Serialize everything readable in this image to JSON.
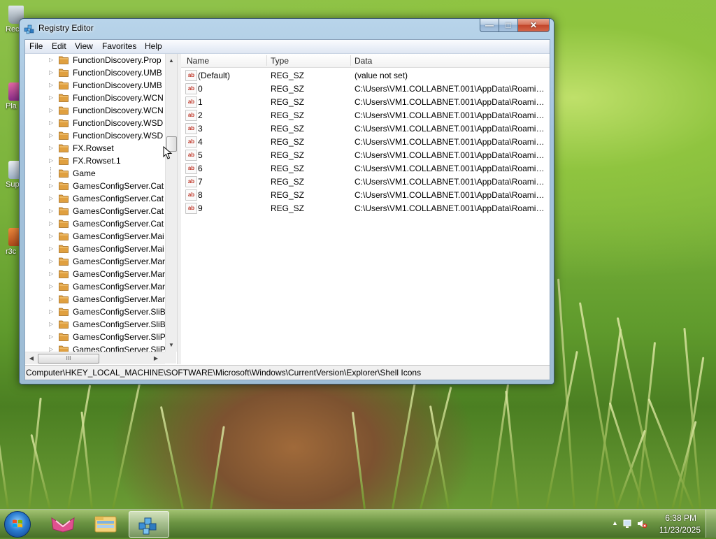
{
  "window": {
    "title": "Registry Editor",
    "min_glyph": "—",
    "max_glyph": "□",
    "close_glyph": "✕"
  },
  "menu": [
    "File",
    "Edit",
    "View",
    "Favorites",
    "Help"
  ],
  "tree": {
    "items": [
      {
        "label": "FunctionDiscovery.Prop",
        "expandable": true
      },
      {
        "label": "FunctionDiscovery.UMB",
        "expandable": true
      },
      {
        "label": "FunctionDiscovery.UMB",
        "expandable": true
      },
      {
        "label": "FunctionDiscovery.WCN",
        "expandable": true
      },
      {
        "label": "FunctionDiscovery.WCN",
        "expandable": true
      },
      {
        "label": "FunctionDiscovery.WSD",
        "expandable": true
      },
      {
        "label": "FunctionDiscovery.WSD",
        "expandable": true
      },
      {
        "label": "FX.Rowset",
        "expandable": true
      },
      {
        "label": "FX.Rowset.1",
        "expandable": true
      },
      {
        "label": "Game",
        "expandable": false
      },
      {
        "label": "GamesConfigServer.Cat",
        "expandable": true
      },
      {
        "label": "GamesConfigServer.Cat",
        "expandable": true
      },
      {
        "label": "GamesConfigServer.Cat",
        "expandable": true
      },
      {
        "label": "GamesConfigServer.Cat",
        "expandable": true
      },
      {
        "label": "GamesConfigServer.Mai",
        "expandable": true
      },
      {
        "label": "GamesConfigServer.Mai",
        "expandable": true
      },
      {
        "label": "GamesConfigServer.Mar",
        "expandable": true
      },
      {
        "label": "GamesConfigServer.Mar",
        "expandable": true
      },
      {
        "label": "GamesConfigServer.Mar",
        "expandable": true
      },
      {
        "label": "GamesConfigServer.Mar",
        "expandable": true
      },
      {
        "label": "GamesConfigServer.SliB",
        "expandable": true
      },
      {
        "label": "GamesConfigServer.SliB",
        "expandable": true
      },
      {
        "label": "GamesConfigServer.SliP",
        "expandable": true
      },
      {
        "label": "GamesConfigServer.SliP",
        "expandable": true
      }
    ],
    "scroll_up": "▲",
    "scroll_down": "▼",
    "scroll_left": "◀",
    "scroll_right": "▶",
    "hthumb_grip": "III"
  },
  "list": {
    "columns": [
      "Name",
      "Type",
      "Data"
    ],
    "rows": [
      {
        "name": "(Default)",
        "type": "REG_SZ",
        "data": "(value not set)"
      },
      {
        "name": "0",
        "type": "REG_SZ",
        "data": "C:\\Users\\VM1.COLLABNET.001\\AppData\\Roaming..."
      },
      {
        "name": "1",
        "type": "REG_SZ",
        "data": "C:\\Users\\VM1.COLLABNET.001\\AppData\\Roaming..."
      },
      {
        "name": "2",
        "type": "REG_SZ",
        "data": "C:\\Users\\VM1.COLLABNET.001\\AppData\\Roaming..."
      },
      {
        "name": "3",
        "type": "REG_SZ",
        "data": "C:\\Users\\VM1.COLLABNET.001\\AppData\\Roaming..."
      },
      {
        "name": "4",
        "type": "REG_SZ",
        "data": "C:\\Users\\VM1.COLLABNET.001\\AppData\\Roaming..."
      },
      {
        "name": "5",
        "type": "REG_SZ",
        "data": "C:\\Users\\VM1.COLLABNET.001\\AppData\\Roaming..."
      },
      {
        "name": "6",
        "type": "REG_SZ",
        "data": "C:\\Users\\VM1.COLLABNET.001\\AppData\\Roaming..."
      },
      {
        "name": "7",
        "type": "REG_SZ",
        "data": "C:\\Users\\VM1.COLLABNET.001\\AppData\\Roaming..."
      },
      {
        "name": "8",
        "type": "REG_SZ",
        "data": "C:\\Users\\VM1.COLLABNET.001\\AppData\\Roaming..."
      },
      {
        "name": "9",
        "type": "REG_SZ",
        "data": "C:\\Users\\VM1.COLLABNET.001\\AppData\\Roaming..."
      }
    ],
    "value_icon": "ab"
  },
  "status": {
    "path": "Computer\\HKEY_LOCAL_MACHINE\\SOFTWARE\\Microsoft\\Windows\\CurrentVersion\\Explorer\\Shell Icons"
  },
  "desktop_icons": [
    "Rec",
    "Pla",
    "Sup",
    "r3c"
  ],
  "taskbar": {
    "clock_time": "6:38 PM",
    "clock_date": "11/23/2025",
    "items": [
      "start-orb",
      "app-pink",
      "file-explorer",
      "registry-editor"
    ],
    "active_item": "registry-editor"
  },
  "colors": {
    "folder": "#e0a040",
    "title_glass": "#a9c6e0",
    "close_red": "#c9452b",
    "desktop_green": "#79b13a"
  }
}
